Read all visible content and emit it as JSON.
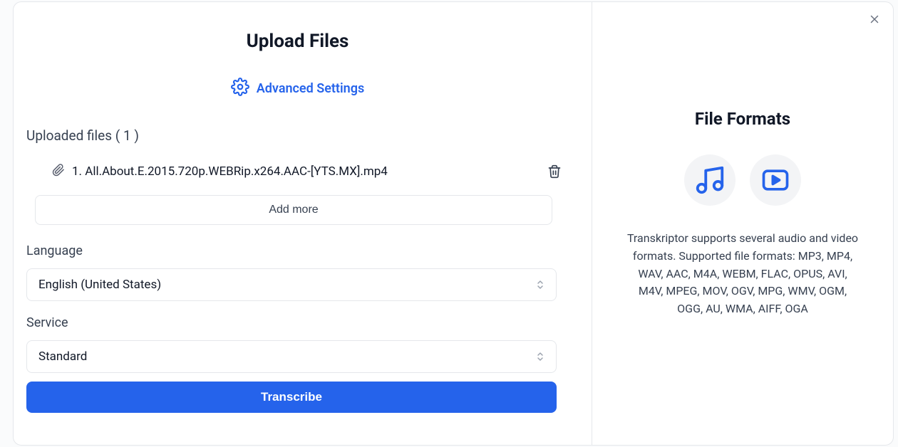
{
  "header": {
    "title": "Upload Files",
    "advanced_settings": "Advanced Settings"
  },
  "uploads": {
    "label": "Uploaded files ( 1 )",
    "files": [
      {
        "name": "1. All.About.E.2015.720p.WEBRip.x264.AAC-[YTS.MX].mp4"
      }
    ],
    "add_more_label": "Add more"
  },
  "language": {
    "label": "Language",
    "value": "English (United States)"
  },
  "service": {
    "label": "Service",
    "value": "Standard"
  },
  "actions": {
    "transcribe": "Transcribe"
  },
  "sidebar": {
    "title": "File Formats",
    "description": "Transkriptor supports several audio and video formats. Supported file formats: MP3, MP4, WAV, AAC, M4A, WEBM, FLAC, OPUS, AVI, M4V, MPEG, MOV, OGV, MPG, WMV, OGM, OGG, AU, WMA, AIFF, OGA"
  }
}
